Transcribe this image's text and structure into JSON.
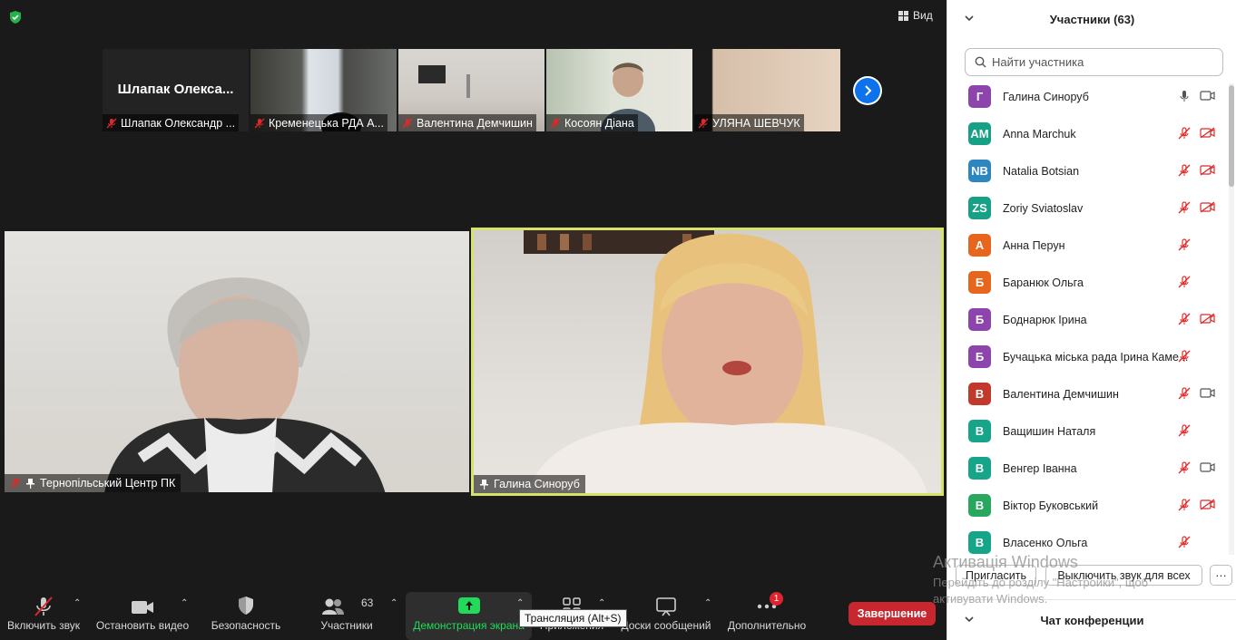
{
  "meeting": {
    "view_label": "Вид",
    "thumbnails": [
      {
        "name": "Шлапак Олександр ...",
        "big_name": "Шлапак  Олекса...",
        "muted": true
      },
      {
        "name": "Кременецька РДА А...",
        "muted": true
      },
      {
        "name": "Валентина Демчишин",
        "muted": true
      },
      {
        "name": "Косоян Діана",
        "muted": true
      },
      {
        "name": "УЛЯНА ШЕВЧУК",
        "muted": true
      }
    ],
    "main_videos": {
      "left": {
        "name": "Тернопільський Центр ПК",
        "muted": true,
        "pinned": true
      },
      "right": {
        "name": "Галина Синоруб",
        "muted": false,
        "pinned": true,
        "active_speaker": true
      }
    }
  },
  "toolbar": {
    "unmute_label": "Включить звук",
    "stop_video_label": "Остановить видео",
    "security_label": "Безопасность",
    "participants_label": "Участники",
    "participants_count": "63",
    "share_label": "Демонстрация экрана",
    "apps_label": "Приложения",
    "whiteboards_label": "Доски сообщений",
    "more_label": "Дополнительно",
    "more_badge": "1",
    "end_label": "Завершение",
    "share_tooltip": "Трансляция (Alt+S)",
    "share_color": "#23d959",
    "end_color": "#c8272f"
  },
  "panel": {
    "title": "Участники (63)",
    "search_placeholder": "Найти участника",
    "participants": [
      {
        "initials": "Г",
        "name": "Галина Синоруб",
        "color": "#8e44ad",
        "mic": "on",
        "cam": "on"
      },
      {
        "initials": "AM",
        "name": "Anna Marchuk",
        "color": "#16a085",
        "mic": "muted",
        "cam": "off"
      },
      {
        "initials": "NB",
        "name": "Natalia Botsian",
        "color": "#2e86c1",
        "mic": "muted",
        "cam": "off"
      },
      {
        "initials": "ZS",
        "name": "Zoriy Sviatoslav",
        "color": "#16a085",
        "mic": "muted",
        "cam": "off"
      },
      {
        "initials": "А",
        "name": "Анна Перун",
        "color": "#e8651e",
        "mic": "muted",
        "cam": "none"
      },
      {
        "initials": "Б",
        "name": "Баранюк Ольга",
        "color": "#e8651e",
        "mic": "muted",
        "cam": "none"
      },
      {
        "initials": "Б",
        "name": "Боднарюк Ірина",
        "color": "#8e44ad",
        "mic": "muted",
        "cam": "off"
      },
      {
        "initials": "Б",
        "name": "Бучацька міська рада Ірина Каме...",
        "color": "#8e44ad",
        "mic": "muted",
        "cam": "none"
      },
      {
        "initials": "В",
        "name": "Валентина Демчишин",
        "color": "#c0392b",
        "mic": "muted",
        "cam": "on"
      },
      {
        "initials": "В",
        "name": "Ващишин Наталя",
        "color": "#17a589",
        "mic": "muted",
        "cam": "none"
      },
      {
        "initials": "В",
        "name": "Венгер Іванна",
        "color": "#17a589",
        "mic": "muted",
        "cam": "on"
      },
      {
        "initials": "В",
        "name": "Віктор Буковський",
        "color": "#28a85e",
        "mic": "muted",
        "cam": "off"
      },
      {
        "initials": "В",
        "name": "Власенко Ольга",
        "color": "#17a589",
        "mic": "muted",
        "cam": "none"
      }
    ],
    "invite_label": "Пригласить",
    "mute_all_label": "Выключить звук для всех",
    "more_label": "···",
    "chat_title": "Чат конференции"
  },
  "watermark": {
    "line1": "Активація Windows",
    "line2": "Перейдіть до розділу \"Настройки\", щоб",
    "line3": "активувати Windows."
  }
}
